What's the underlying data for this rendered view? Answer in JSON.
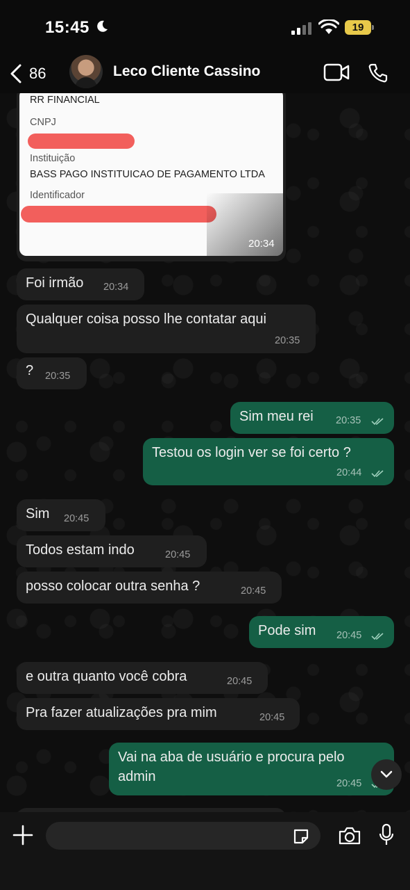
{
  "status_bar": {
    "time": "15:45",
    "battery": "19"
  },
  "header": {
    "back_count": "86",
    "contact_name": "Leco Cliente Cassino"
  },
  "image_card": {
    "company": "RR FINANCIAL",
    "cnpj_label": "CNPJ",
    "institution_label": "Instituição",
    "institution_value": "BASS PAGO INSTITUICAO DE PAGAMENTO LTDA",
    "identifier_label": "Identificador",
    "time": "20:34"
  },
  "messages": [
    {
      "text": "Foi irmão",
      "time": "20:34",
      "direction": "in"
    },
    {
      "text": "Qualquer coisa posso lhe contatar aqui",
      "time": "20:35",
      "direction": "in"
    },
    {
      "text": "?",
      "time": "20:35",
      "direction": "in"
    },
    {
      "text": "Sim meu rei",
      "time": "20:35",
      "direction": "out",
      "read": true
    },
    {
      "text": "Testou os login ver se foi certo ?",
      "time": "20:44",
      "direction": "out",
      "read": true
    },
    {
      "text": "Sim",
      "time": "20:45",
      "direction": "in"
    },
    {
      "text": "Todos estam indo",
      "time": "20:45",
      "direction": "in"
    },
    {
      "text": "posso colocar outra senha ?",
      "time": "20:45",
      "direction": "in"
    },
    {
      "text": "Pode sim",
      "time": "20:45",
      "direction": "out",
      "read": true
    },
    {
      "text": "e outra quanto você cobra",
      "time": "20:45",
      "direction": "in"
    },
    {
      "text": "Pra fazer atualizações pra mim",
      "time": "20:45",
      "direction": "in"
    },
    {
      "text_line1": "Vai na aba de usuário e procura pelo",
      "text_line2": "admin",
      "time": "20:45",
      "direction": "out",
      "read": true
    }
  ],
  "input": {
    "value": "",
    "placeholder": ""
  },
  "colors": {
    "incoming_bubble": "#1f1f1f",
    "outgoing_bubble": "#155f45",
    "read_check": "#9fd0bd",
    "redaction": "#f25f5c"
  },
  "icons": [
    "moon-icon",
    "signal-icon",
    "wifi-icon",
    "back-chevron-icon",
    "video-call-icon",
    "phone-icon",
    "double-check-icon",
    "chevron-down-icon",
    "plus-icon",
    "sticker-icon",
    "camera-icon",
    "microphone-icon"
  ]
}
